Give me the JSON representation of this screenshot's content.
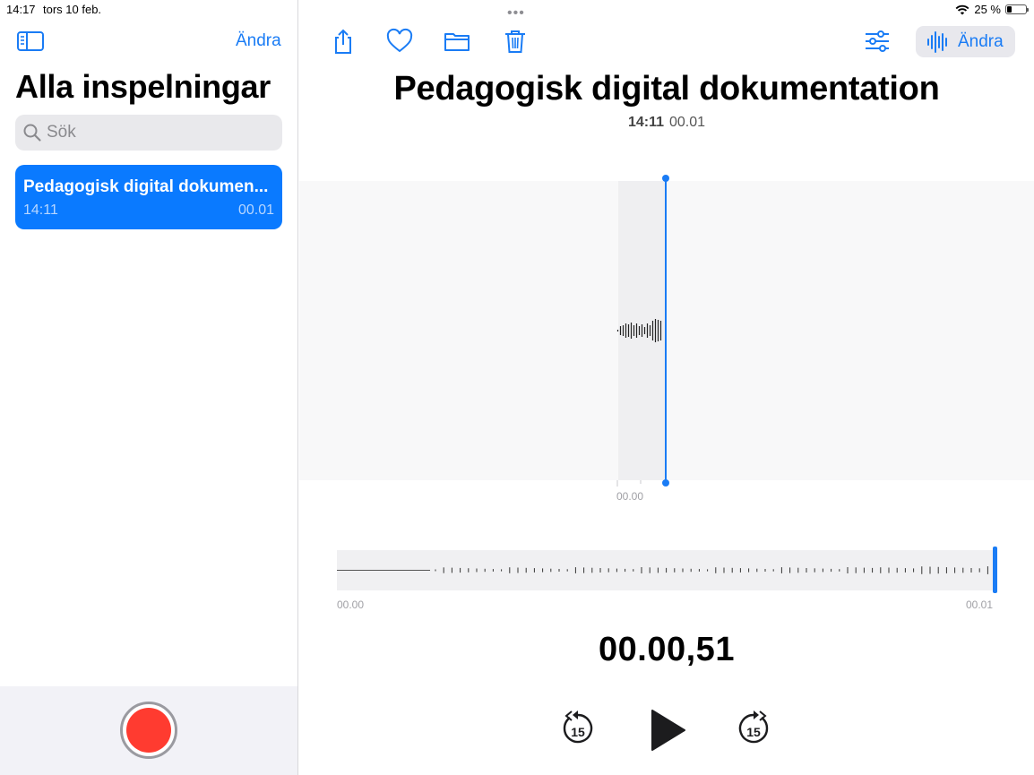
{
  "status_bar": {
    "time": "14:17",
    "date": "tors 10 feb.",
    "battery": "25 %",
    "battery_level": 0.25
  },
  "sidebar": {
    "edit_label": "Ändra",
    "title": "Alla inspelningar",
    "search_placeholder": "Sök",
    "recordings": [
      {
        "title": "Pedagogisk digital dokumen...",
        "time": "14:11",
        "duration": "00.01"
      }
    ]
  },
  "toolbar": {
    "edit_label": "Ändra"
  },
  "recording": {
    "title": "Pedagogisk digital dokumentation",
    "time": "14:11",
    "duration": "00.01",
    "waveform_tick": "00.00",
    "overview_start": "00.00",
    "overview_end": "00.01",
    "elapsed": "00.00,51"
  },
  "colors": {
    "accent": "#1a7cf5",
    "record": "#ff3b30",
    "selected_row": "#0a7aff"
  }
}
